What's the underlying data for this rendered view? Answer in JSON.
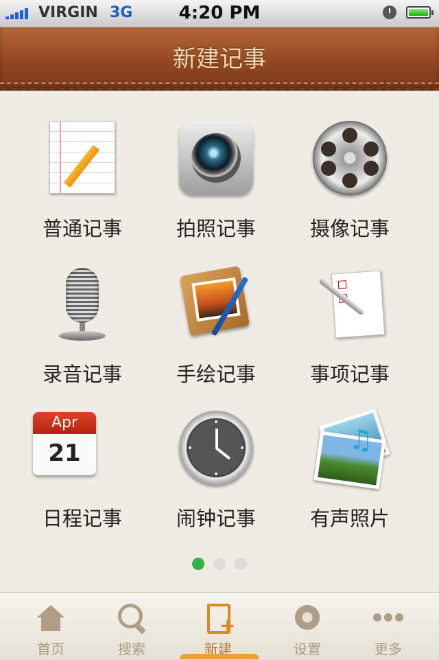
{
  "status": {
    "carrier": "VIRGIN",
    "network": "3G",
    "time": "4:20 PM"
  },
  "header": {
    "title": "新建记事"
  },
  "grid": {
    "items": [
      {
        "label": "普通记事",
        "icon": "notepad-icon"
      },
      {
        "label": "拍照记事",
        "icon": "camera-icon"
      },
      {
        "label": "摄像记事",
        "icon": "film-reel-icon"
      },
      {
        "label": "录音记事",
        "icon": "microphone-icon"
      },
      {
        "label": "手绘记事",
        "icon": "drawing-board-icon"
      },
      {
        "label": "事项记事",
        "icon": "checklist-icon"
      },
      {
        "label": "日程记事",
        "icon": "calendar-icon"
      },
      {
        "label": "闹钟记事",
        "icon": "alarm-clock-icon"
      },
      {
        "label": "有声照片",
        "icon": "sound-photo-icon"
      }
    ]
  },
  "calendar": {
    "month": "Apr",
    "day": "21"
  },
  "pager": {
    "pages": 3,
    "active": 1
  },
  "tabbar": {
    "tabs": [
      {
        "label": "首页",
        "icon": "home-icon"
      },
      {
        "label": "搜索",
        "icon": "search-icon"
      },
      {
        "label": "新建",
        "icon": "new-note-icon"
      },
      {
        "label": "设置",
        "icon": "gear-icon"
      },
      {
        "label": "更多",
        "icon": "more-icon"
      }
    ],
    "active": 2
  },
  "colors": {
    "header": "#8f4520",
    "accent": "#d98b22",
    "pager_active": "#34b14a"
  }
}
